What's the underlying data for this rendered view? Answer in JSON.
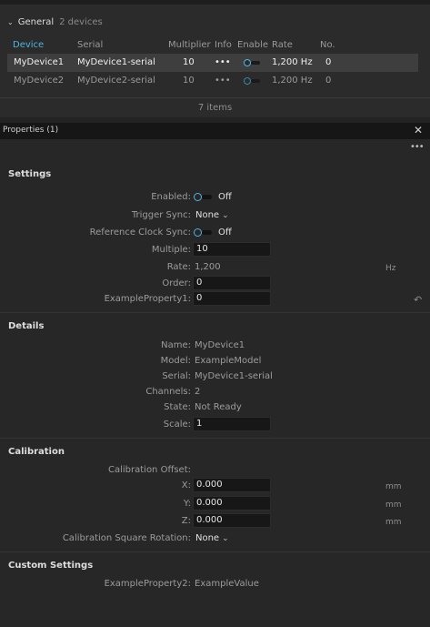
{
  "device_panel": {
    "group": {
      "name": "General",
      "count": "2 devices"
    },
    "columns": {
      "device": "Device",
      "serial": "Serial",
      "multiplier": "Multiplier",
      "info": "Info",
      "enable": "Enable",
      "rate": "Rate",
      "no": "No."
    },
    "rows": [
      {
        "device": "MyDevice1",
        "serial": "MyDevice1-serial",
        "multiplier": "10",
        "info": "•••",
        "enabled": false,
        "rate": "1,200 Hz",
        "no": "0",
        "selected": true
      },
      {
        "device": "MyDevice2",
        "serial": "MyDevice2-serial",
        "multiplier": "10",
        "info": "•••",
        "enabled": false,
        "rate": "1,200 Hz",
        "no": "0",
        "selected": false
      }
    ],
    "items_count": "7 items"
  },
  "properties": {
    "title": "Properties (1)",
    "close_icon": "✕",
    "more_icon": "•••",
    "settings": {
      "title": "Settings",
      "enabled": {
        "label": "Enabled:",
        "value": "Off"
      },
      "trigger_sync": {
        "label": "Trigger Sync:",
        "value": "None"
      },
      "reference_clock_sync": {
        "label": "Reference Clock Sync:",
        "value": "Off"
      },
      "multiple": {
        "label": "Multiple:",
        "value": "10"
      },
      "rate": {
        "label": "Rate:",
        "value": "1,200",
        "unit": "Hz"
      },
      "order": {
        "label": "Order:",
        "value": "0"
      },
      "example_property1": {
        "label": "ExampleProperty1:",
        "value": "0"
      }
    },
    "details": {
      "title": "Details",
      "name": {
        "label": "Name:",
        "value": "MyDevice1"
      },
      "model": {
        "label": "Model:",
        "value": "ExampleModel"
      },
      "serial": {
        "label": "Serial:",
        "value": "MyDevice1-serial"
      },
      "channels": {
        "label": "Channels:",
        "value": "2"
      },
      "state": {
        "label": "State:",
        "value": "Not Ready"
      },
      "scale": {
        "label": "Scale:",
        "value": "1"
      }
    },
    "calibration": {
      "title": "Calibration",
      "offset_label": "Calibration Offset:",
      "x": {
        "label": "X:",
        "value": "0.000",
        "unit": "mm"
      },
      "y": {
        "label": "Y:",
        "value": "0.000",
        "unit": "mm"
      },
      "z": {
        "label": "Z:",
        "value": "0.000",
        "unit": "mm"
      },
      "square_rotation": {
        "label": "Calibration Square Rotation:",
        "value": "None"
      }
    },
    "custom_settings": {
      "title": "Custom Settings",
      "example_property2": {
        "label": "ExampleProperty2:",
        "value": "ExampleValue"
      }
    }
  },
  "colors": {
    "accent": "#4db6e3",
    "background": "#232323",
    "panel": "#272727",
    "field": "#171717"
  }
}
